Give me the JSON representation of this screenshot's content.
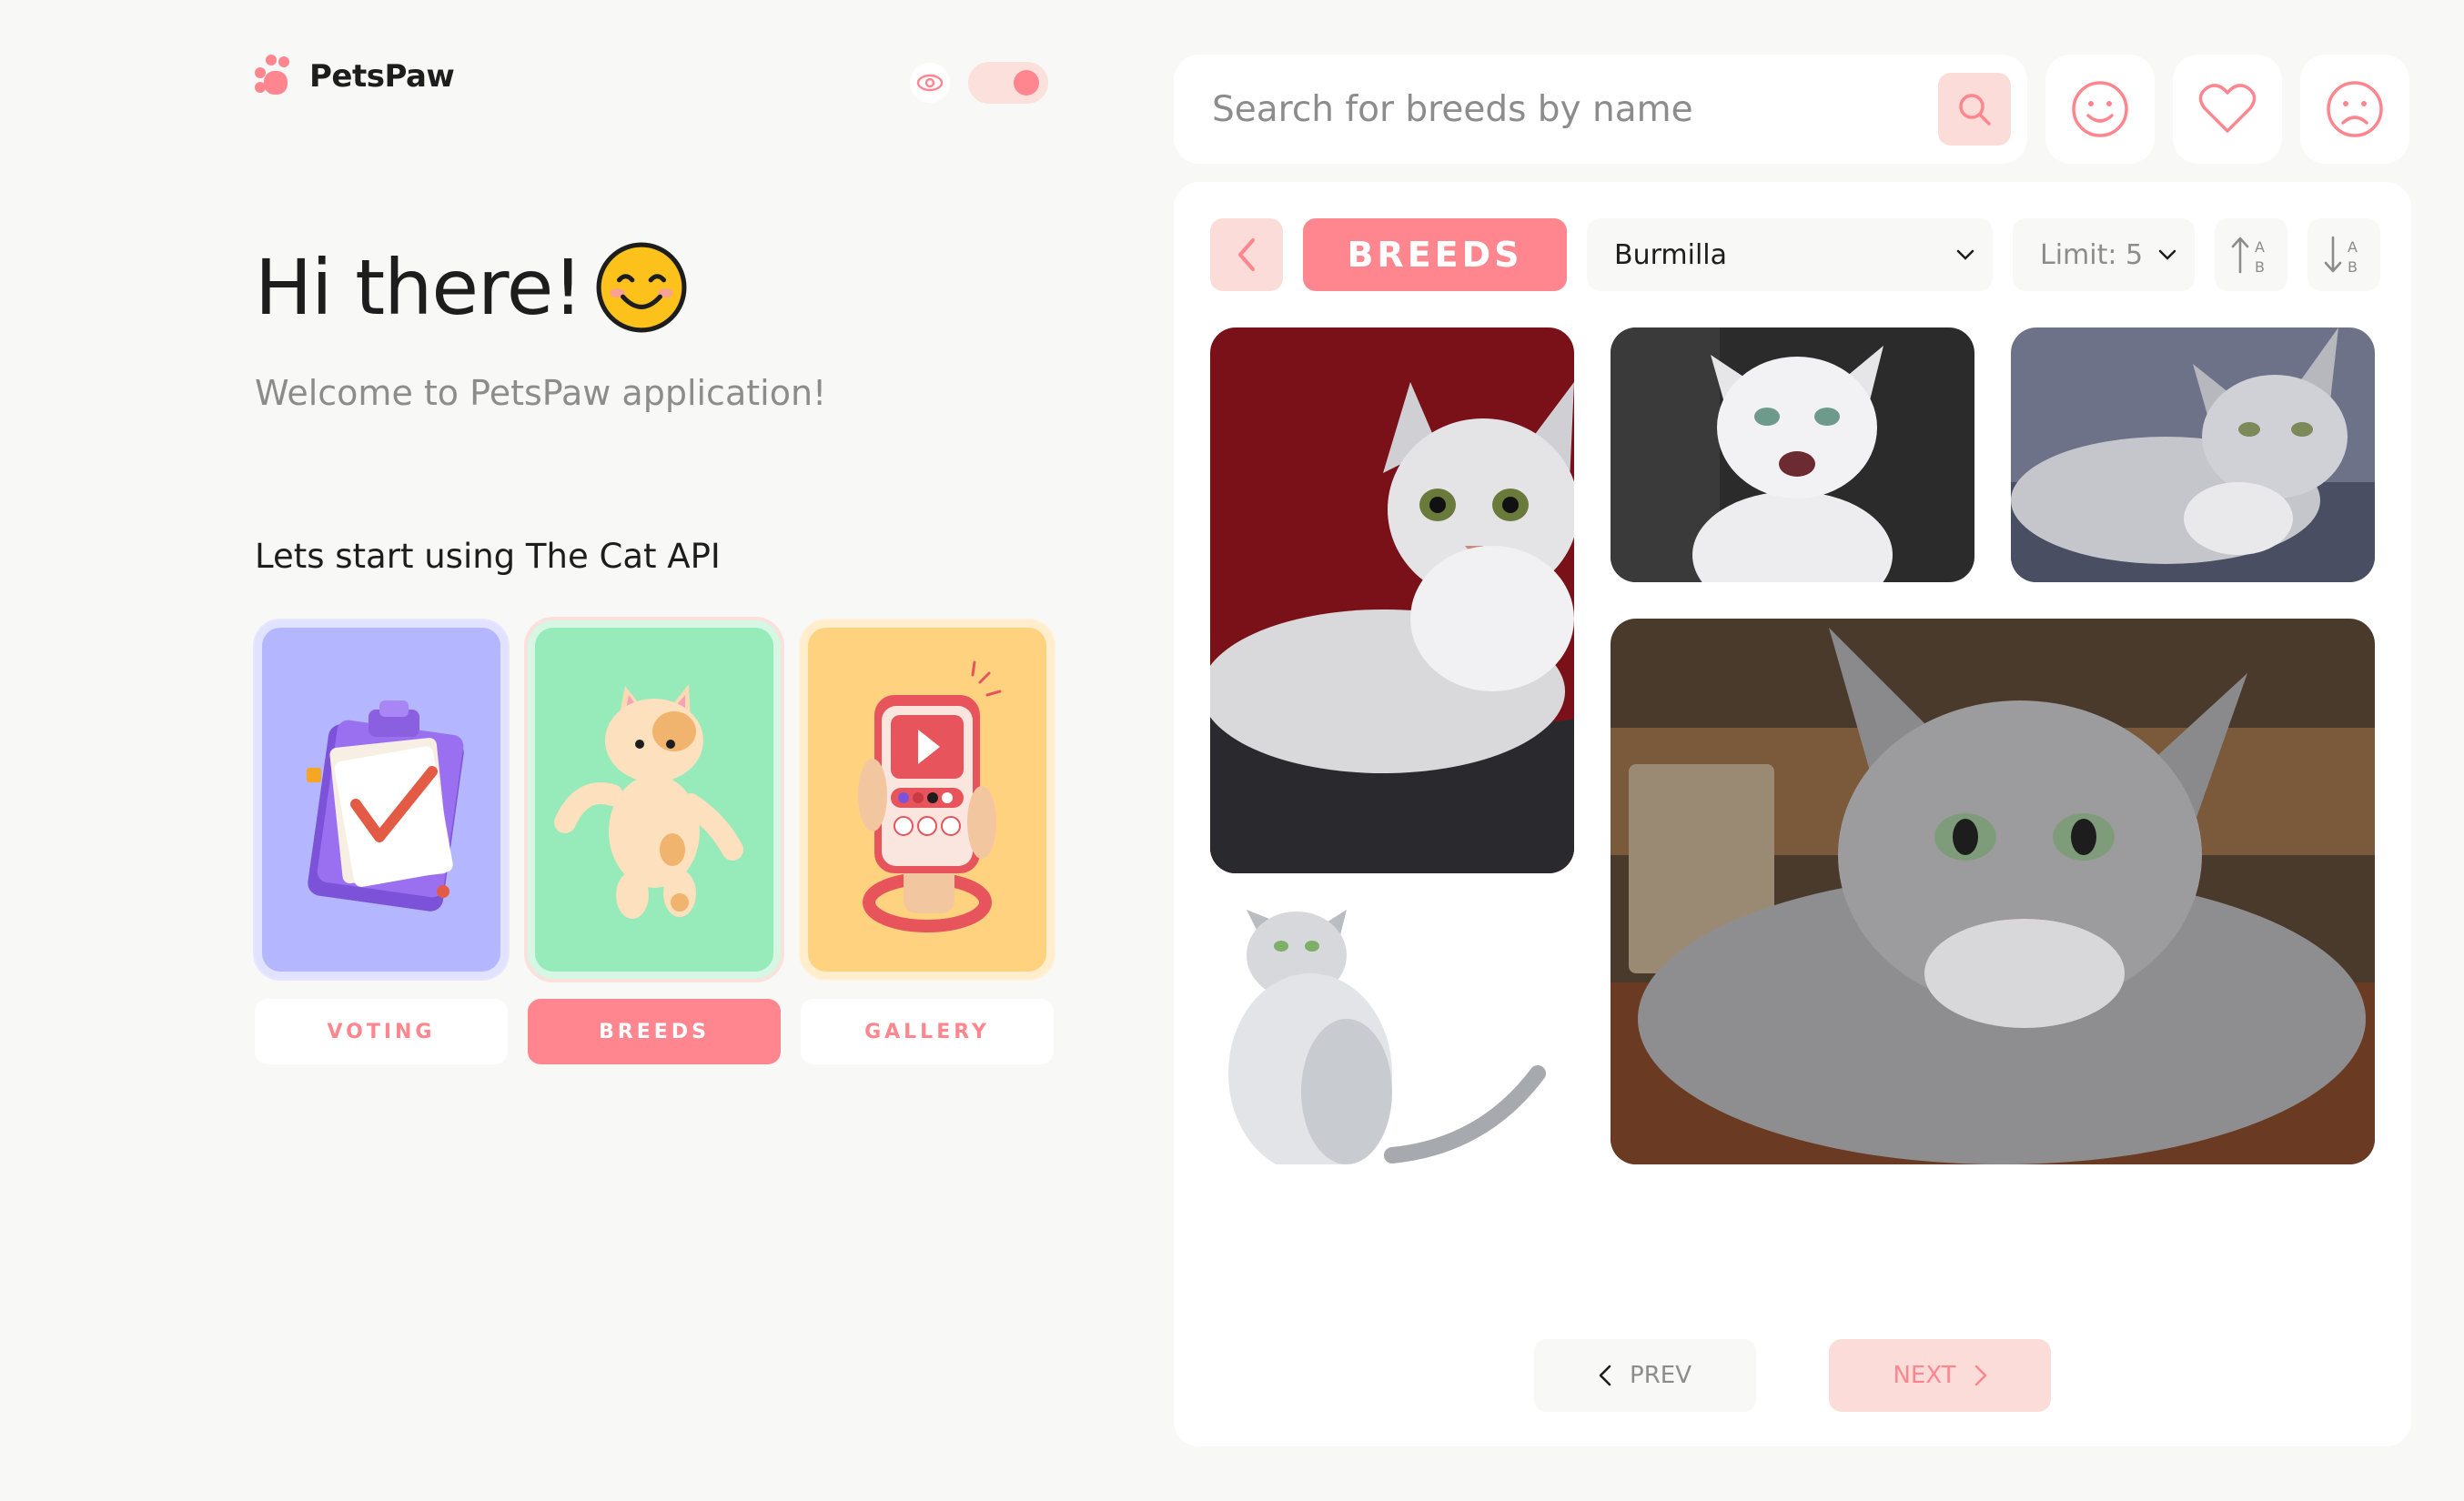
{
  "brand": {
    "name": "PetsPaw",
    "accent": "#ff868e"
  },
  "theme": {
    "eye_icon": "eye-icon",
    "dark_mode": true
  },
  "hero": {
    "greeting": "Hi there!",
    "welcome": "Welcome to PetsPaw application!",
    "subtitle": "Lets start using The Cat API"
  },
  "nav_cards": [
    {
      "label": "VOTING",
      "color": "#b4b7ff",
      "active": false
    },
    {
      "label": "BREEDS",
      "color": "#97eab9",
      "active": true
    },
    {
      "label": "GALLERY",
      "color": "#ffd280",
      "active": false
    }
  ],
  "search": {
    "placeholder": "Search for breeds by name"
  },
  "top_icons": [
    "smile-icon",
    "heart-icon",
    "sad-icon"
  ],
  "toolbar": {
    "title": "BREEDS",
    "breed_selected": "Burmilla",
    "limit_selected": "Limit: 5"
  },
  "pager": {
    "prev": "PREV",
    "next": "NEXT"
  }
}
